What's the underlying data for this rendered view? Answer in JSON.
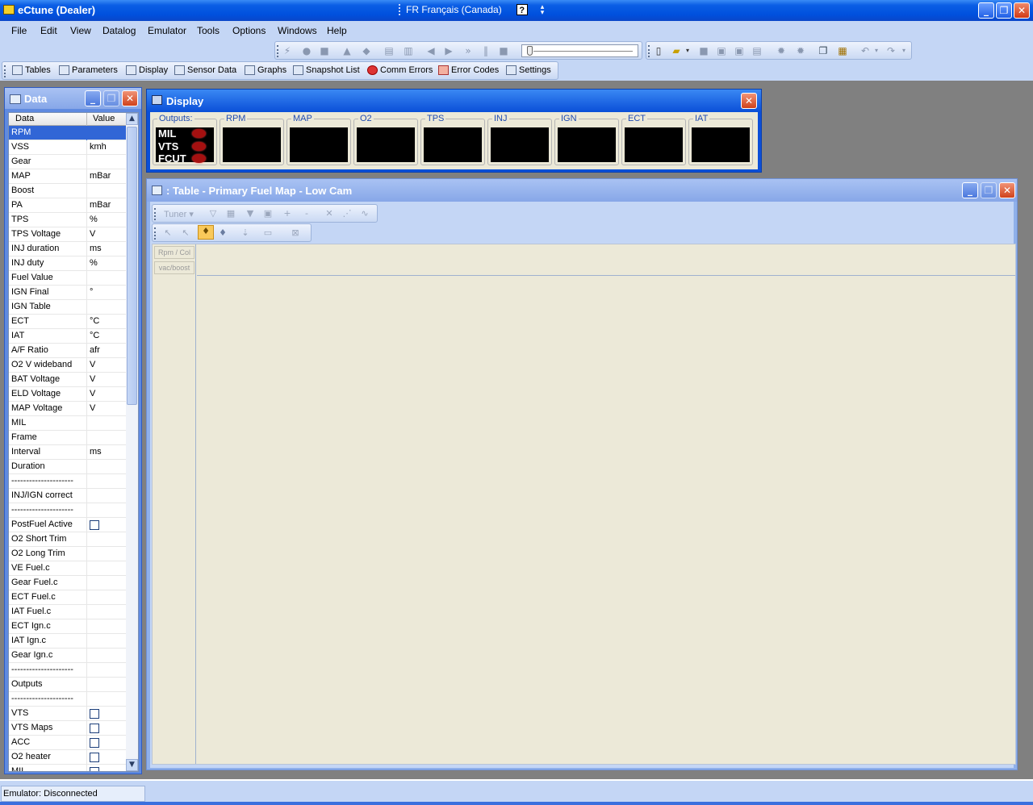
{
  "window": {
    "title": "eCtune (Dealer)",
    "language": "FR Français (Canada)",
    "help_glyph": "?",
    "controls": {
      "minimize": "_",
      "restore": "❐",
      "close": "✕"
    }
  },
  "menu": [
    "File",
    "Edit",
    "View",
    "Datalog",
    "Emulator",
    "Tools",
    "Options",
    "Windows",
    "Help"
  ],
  "toolbar_views": [
    {
      "label": "Tables",
      "icon": "table-icon"
    },
    {
      "label": "Parameters",
      "icon": "parameters-icon"
    },
    {
      "label": "Display",
      "icon": "display-icon"
    },
    {
      "label": "Sensor Data",
      "icon": "sensor-data-icon"
    },
    {
      "label": "Graphs",
      "icon": "graphs-icon"
    },
    {
      "label": "Snapshot List",
      "icon": "snapshot-icon"
    },
    {
      "label": "Comm Errors",
      "icon": "comm-errors-icon"
    },
    {
      "label": "Error Codes",
      "icon": "error-codes-icon"
    },
    {
      "label": "Settings",
      "icon": "settings-icon"
    }
  ],
  "data_panel": {
    "title": "Data",
    "col_data": "Data",
    "col_value": "Value",
    "rows": [
      {
        "k": "RPM",
        "v": ""
      },
      {
        "k": "VSS",
        "v": "kmh"
      },
      {
        "k": "Gear",
        "v": ""
      },
      {
        "k": "MAP",
        "v": "mBar"
      },
      {
        "k": "Boost",
        "v": ""
      },
      {
        "k": "PA",
        "v": "mBar"
      },
      {
        "k": "TPS",
        "v": "%"
      },
      {
        "k": "TPS Voltage",
        "v": "V"
      },
      {
        "k": "INJ duration",
        "v": "ms"
      },
      {
        "k": "INJ duty",
        "v": "%"
      },
      {
        "k": "Fuel Value",
        "v": ""
      },
      {
        "k": "IGN Final",
        "v": "°"
      },
      {
        "k": "IGN Table",
        "v": ""
      },
      {
        "k": "ECT",
        "v": "°C"
      },
      {
        "k": "IAT",
        "v": "°C"
      },
      {
        "k": "A/F Ratio",
        "v": "afr"
      },
      {
        "k": "O2 V wideband",
        "v": "V"
      },
      {
        "k": "BAT Voltage",
        "v": "V"
      },
      {
        "k": "ELD Voltage",
        "v": "V"
      },
      {
        "k": "MAP Voltage",
        "v": "V"
      },
      {
        "k": "MIL",
        "v": ""
      },
      {
        "k": "Frame",
        "v": ""
      },
      {
        "k": "Interval",
        "v": "ms"
      },
      {
        "k": "Duration",
        "v": ""
      },
      {
        "k": "---------------------",
        "v": ""
      },
      {
        "k": "INJ/IGN correct",
        "v": ""
      },
      {
        "k": "---------------------",
        "v": ""
      },
      {
        "k": "PostFuel Active",
        "v": "",
        "cb": true
      },
      {
        "k": "O2 Short Trim",
        "v": ""
      },
      {
        "k": "O2 Long Trim",
        "v": ""
      },
      {
        "k": "VE Fuel.c",
        "v": ""
      },
      {
        "k": "Gear Fuel.c",
        "v": ""
      },
      {
        "k": "ECT Fuel.c",
        "v": ""
      },
      {
        "k": "IAT Fuel.c",
        "v": ""
      },
      {
        "k": "ECT Ign.c",
        "v": ""
      },
      {
        "k": "IAT Ign.c",
        "v": ""
      },
      {
        "k": "Gear Ign.c",
        "v": ""
      },
      {
        "k": "---------------------",
        "v": ""
      },
      {
        "k": "Outputs",
        "v": ""
      },
      {
        "k": "---------------------",
        "v": ""
      },
      {
        "k": "VTS",
        "v": "",
        "cb": true
      },
      {
        "k": "VTS Maps",
        "v": "",
        "cb": true
      },
      {
        "k": "ACC",
        "v": "",
        "cb": true
      },
      {
        "k": "O2 heater",
        "v": "",
        "cb": true
      },
      {
        "k": "MIL",
        "v": "",
        "cb": true
      }
    ]
  },
  "display": {
    "title": "Display",
    "outputs_label": "Outputs:",
    "outputs": [
      "MIL",
      "VTS",
      "FCUT"
    ],
    "gauges": [
      "RPM",
      "MAP",
      "O2",
      "TPS",
      "INJ",
      "IGN",
      "ECT",
      "IAT"
    ]
  },
  "table": {
    "title": ": Table - Primary Fuel Map - Low Cam",
    "tuner_label": "Tuner",
    "row_header_1": "Rpm / Col",
    "row_header_2": "vac/boost"
  },
  "status": {
    "text": "Emulator: Disconnected"
  }
}
